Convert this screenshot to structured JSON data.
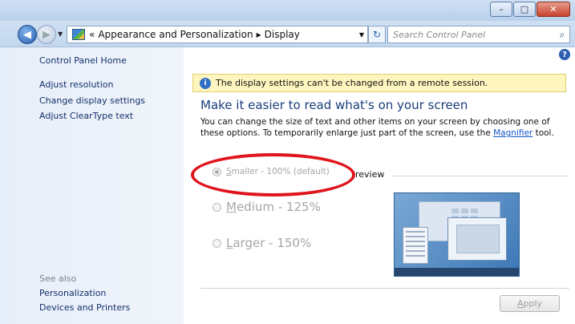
{
  "window": {
    "buttons": {
      "minimize": "–",
      "maximize": "□",
      "close": "✕"
    }
  },
  "address": {
    "back_icon": "◀",
    "forward_icon": "▶",
    "crumbs": [
      "«",
      "Appearance and Personalization",
      "▸",
      "Display"
    ],
    "dropdown_icon": "▼",
    "refresh_icon": "↻",
    "search_placeholder": "Search Control Panel",
    "search_icon": "⌕"
  },
  "sidebar": {
    "home": "Control Panel Home",
    "links": [
      "Adjust resolution",
      "Change display settings",
      "Adjust ClearType text"
    ],
    "see_also_label": "See also",
    "see_also_links": [
      "Personalization",
      "Devices and Printers"
    ]
  },
  "main": {
    "help_icon": "?",
    "info_icon": "i",
    "info_text": "The display settings can't be changed from a remote session.",
    "heading": "Make it easier to read what's on your screen",
    "desc_before": "You can change the size of text and other items on your screen by choosing one of these options. To temporarily enlarge just part of the screen, use the ",
    "desc_link": "Magnifier",
    "desc_after": " tool.",
    "options": [
      {
        "key": "S",
        "rest": "maller - 100% (default)",
        "selected": true
      },
      {
        "key": "M",
        "rest": "edium - 125%",
        "selected": false
      },
      {
        "key": "L",
        "rest": "arger - 150%",
        "selected": false
      }
    ],
    "preview_label": "review",
    "apply_key": "A",
    "apply_rest": "pply"
  },
  "colors": {
    "annotation": "#e0141c",
    "link": "#1756c8",
    "heading": "#1a3e7a",
    "infobar": "#fff6bf"
  }
}
